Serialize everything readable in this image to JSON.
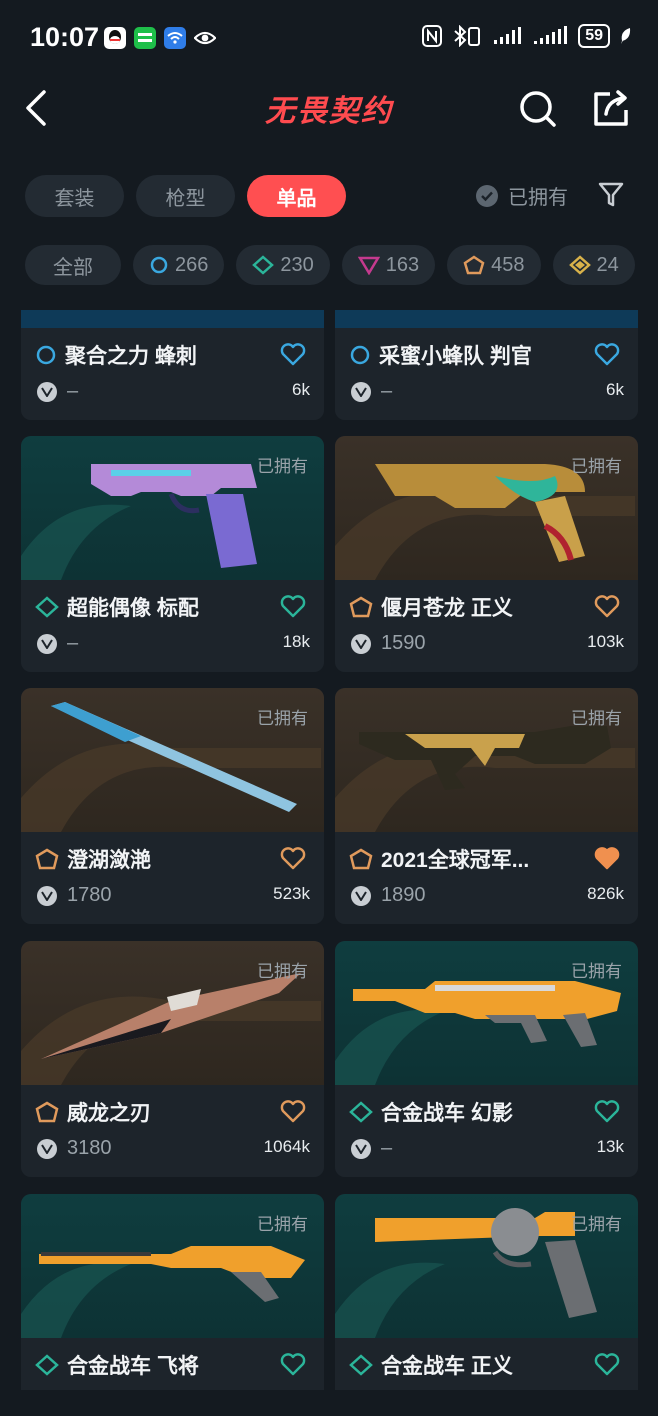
{
  "status": {
    "time": "10:07",
    "battery": "59",
    "app_icons": [
      "qq-icon",
      "iqiyi-icon",
      "wifi-app-icon",
      "eye-icon"
    ],
    "right_icons": [
      "nfc-icon",
      "bluetooth-icon",
      "signal-icon",
      "signal-icon",
      "leaf-icon"
    ]
  },
  "header": {
    "title": "无畏契约"
  },
  "tabs": [
    {
      "label": "套装",
      "active": false
    },
    {
      "label": "枪型",
      "active": false
    },
    {
      "label": "单品",
      "active": true
    }
  ],
  "owned_filter": {
    "label": "已拥有"
  },
  "tiers": [
    {
      "label": "全部"
    },
    {
      "count": "266",
      "color": "#3aa8e0",
      "icon": "select-tier-icon"
    },
    {
      "count": "230",
      "color": "#2bb59a",
      "icon": "deluxe-tier-icon"
    },
    {
      "count": "163",
      "color": "#c43a8e",
      "icon": "premium-tier-icon"
    },
    {
      "count": "458",
      "color": "#e09a5c",
      "icon": "exclusive-tier-icon"
    },
    {
      "count": "24",
      "color": "#d8b24a",
      "icon": "ultra-tier-icon"
    }
  ],
  "cards": [
    {
      "name": "聚合之力 蜂刺",
      "price": "–",
      "likes": "6k",
      "owned": "",
      "tier_color": "#3aa8e0",
      "heart_color": "#3aa8e0",
      "filled": false
    },
    {
      "name": "采蜜小蜂队 判官",
      "price": "–",
      "likes": "6k",
      "owned": "",
      "tier_color": "#3aa8e0",
      "heart_color": "#3aa8e0",
      "filled": false
    },
    {
      "name": "超能偶像 标配",
      "price": "–",
      "likes": "18k",
      "owned": "已拥有",
      "tier_color": "#2bb59a",
      "heart_color": "#2bb59a",
      "filled": false
    },
    {
      "name": "偃月苍龙 正义",
      "price": "1590",
      "likes": "103k",
      "owned": "已拥有",
      "tier_color": "#e09a5c",
      "heart_color": "#e09a5c",
      "filled": false
    },
    {
      "name": "澄湖潋滟",
      "price": "1780",
      "likes": "523k",
      "owned": "已拥有",
      "tier_color": "#e09a5c",
      "heart_color": "#e09a5c",
      "filled": false
    },
    {
      "name": "2021全球冠军...",
      "price": "1890",
      "likes": "826k",
      "owned": "已拥有",
      "tier_color": "#e09a5c",
      "heart_color": "#f0904f",
      "filled": true
    },
    {
      "name": "威龙之刃",
      "price": "3180",
      "likes": "1064k",
      "owned": "已拥有",
      "tier_color": "#e09a5c",
      "heart_color": "#e09a5c",
      "filled": false
    },
    {
      "name": "合金战车 幻影",
      "price": "–",
      "likes": "13k",
      "owned": "已拥有",
      "tier_color": "#2bb59a",
      "heart_color": "#2bb59a",
      "filled": false
    },
    {
      "name": "合金战车 飞将",
      "price": "",
      "likes": "",
      "owned": "已拥有",
      "tier_color": "#2bb59a",
      "heart_color": "#2bb59a",
      "filled": false
    },
    {
      "name": "合金战车 正义",
      "price": "",
      "likes": "",
      "owned": "已拥有",
      "tier_color": "#2bb59a",
      "heart_color": "#2bb59a",
      "filled": false
    }
  ]
}
